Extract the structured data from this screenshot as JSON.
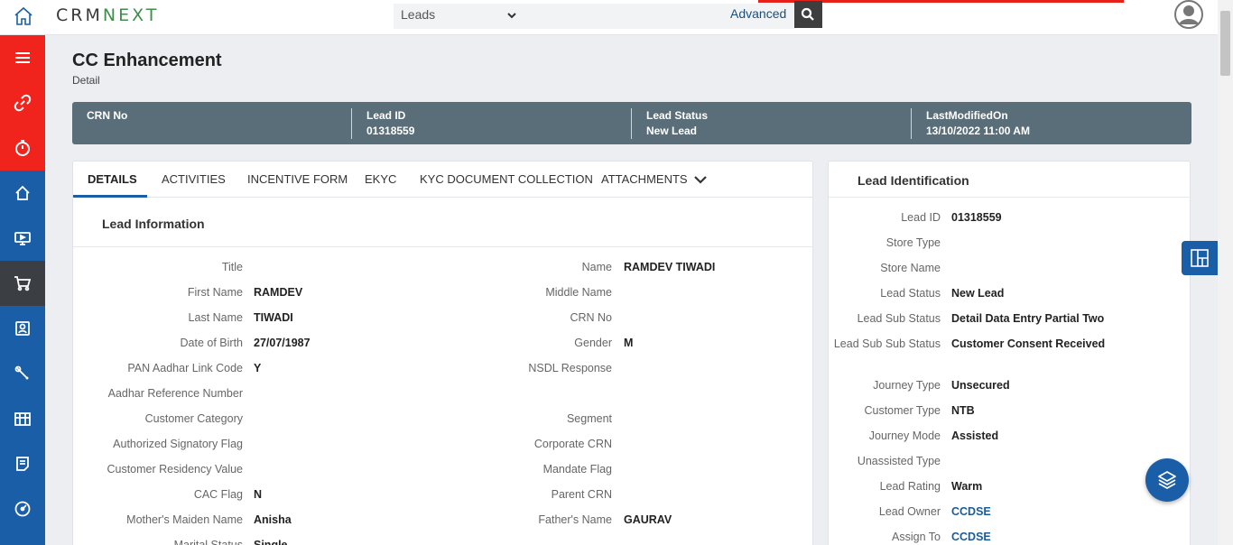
{
  "app": {
    "logo_main": "CRMNEXT",
    "logo_prefix": "CRM",
    "logo_suffix": "NEXT",
    "module_selected": "Leads",
    "advanced_label": "Advanced"
  },
  "colors": {
    "primary": "#1a5ea8",
    "alert": "#f0241d",
    "summary_band": "#5a6e79"
  },
  "sidebar": {
    "items": [
      {
        "icon": "menu-icon",
        "group": "red"
      },
      {
        "icon": "link-icon",
        "group": "red"
      },
      {
        "icon": "timer-icon",
        "group": "red"
      },
      {
        "icon": "home-icon",
        "group": "blue"
      },
      {
        "icon": "monitor-icon",
        "group": "blue"
      },
      {
        "icon": "cart-icon",
        "group": "active"
      },
      {
        "icon": "contact-icon",
        "group": "blue"
      },
      {
        "icon": "wrench-icon",
        "group": "blue"
      },
      {
        "icon": "building-icon",
        "group": "blue"
      },
      {
        "icon": "report-icon",
        "group": "blue"
      },
      {
        "icon": "dashboard-icon",
        "group": "blue"
      }
    ]
  },
  "page": {
    "title": "CC Enhancement",
    "subtitle": "Detail"
  },
  "summary": [
    {
      "label": "CRN No",
      "value": ""
    },
    {
      "label": "Lead ID",
      "value": "01318559"
    },
    {
      "label": "Lead Status",
      "value": "New Lead"
    },
    {
      "label": "LastModifiedOn",
      "value": "13/10/2022 11:00 AM"
    }
  ],
  "tabs": [
    "DETAILS",
    "ACTIVITIES",
    "INCENTIVE FORM",
    "EKYC",
    "KYC DOCUMENT COLLECTION",
    "ATTACHMENTS"
  ],
  "lead_information": {
    "title": "Lead Information",
    "left": [
      {
        "label": "Title",
        "value": ""
      },
      {
        "label": "First Name",
        "value": "RAMDEV"
      },
      {
        "label": "Last Name",
        "value": "TIWADI"
      },
      {
        "label": "Date of Birth",
        "value": "27/07/1987"
      },
      {
        "label": "PAN Aadhar Link Code",
        "value": "Y"
      },
      {
        "label": "Aadhar Reference Number",
        "value": ""
      },
      {
        "label": "Customer Category",
        "value": ""
      },
      {
        "label": "Authorized Signatory Flag",
        "value": ""
      },
      {
        "label": "Customer Residency Value",
        "value": ""
      },
      {
        "label": "CAC Flag",
        "value": "N"
      },
      {
        "label": "Mother's Maiden Name",
        "value": "Anisha"
      },
      {
        "label": "Marital Status",
        "value": "Single"
      }
    ],
    "right": [
      {
        "label": "Name",
        "value": "RAMDEV TIWADI"
      },
      {
        "label": "Middle Name",
        "value": ""
      },
      {
        "label": "CRN No",
        "value": ""
      },
      {
        "label": "Gender",
        "value": "M"
      },
      {
        "label": "NSDL Response",
        "value": ""
      },
      {
        "label": "",
        "value": ""
      },
      {
        "label": "Segment",
        "value": ""
      },
      {
        "label": "Corporate CRN",
        "value": ""
      },
      {
        "label": "Mandate Flag",
        "value": ""
      },
      {
        "label": "Parent CRN",
        "value": ""
      },
      {
        "label": "Father's Name",
        "value": "GAURAV"
      }
    ]
  },
  "lead_identification": {
    "title": "Lead Identification",
    "rows": [
      {
        "label": "Lead ID",
        "value": "01318559",
        "link": false
      },
      {
        "label": "Store Type",
        "value": "",
        "link": false
      },
      {
        "label": "Store Name",
        "value": "",
        "link": false
      },
      {
        "label": "Lead Status",
        "value": "New Lead",
        "link": false
      },
      {
        "label": "Lead Sub Status",
        "value": "Detail Data Entry Partial Two",
        "link": false
      },
      {
        "label": "Lead Sub Sub Status",
        "value": "Customer Consent Received",
        "link": false
      },
      {
        "label": "Journey Type",
        "value": "Unsecured",
        "link": false
      },
      {
        "label": "Customer Type",
        "value": "NTB",
        "link": false
      },
      {
        "label": "Journey Mode",
        "value": "Assisted",
        "link": false
      },
      {
        "label": "Unassisted Type",
        "value": "",
        "link": false
      },
      {
        "label": "Lead Rating",
        "value": "Warm",
        "link": false
      },
      {
        "label": "Lead Owner",
        "value": "CCDSE",
        "link": true
      },
      {
        "label": "Assign To",
        "value": "CCDSE",
        "link": true
      }
    ]
  }
}
